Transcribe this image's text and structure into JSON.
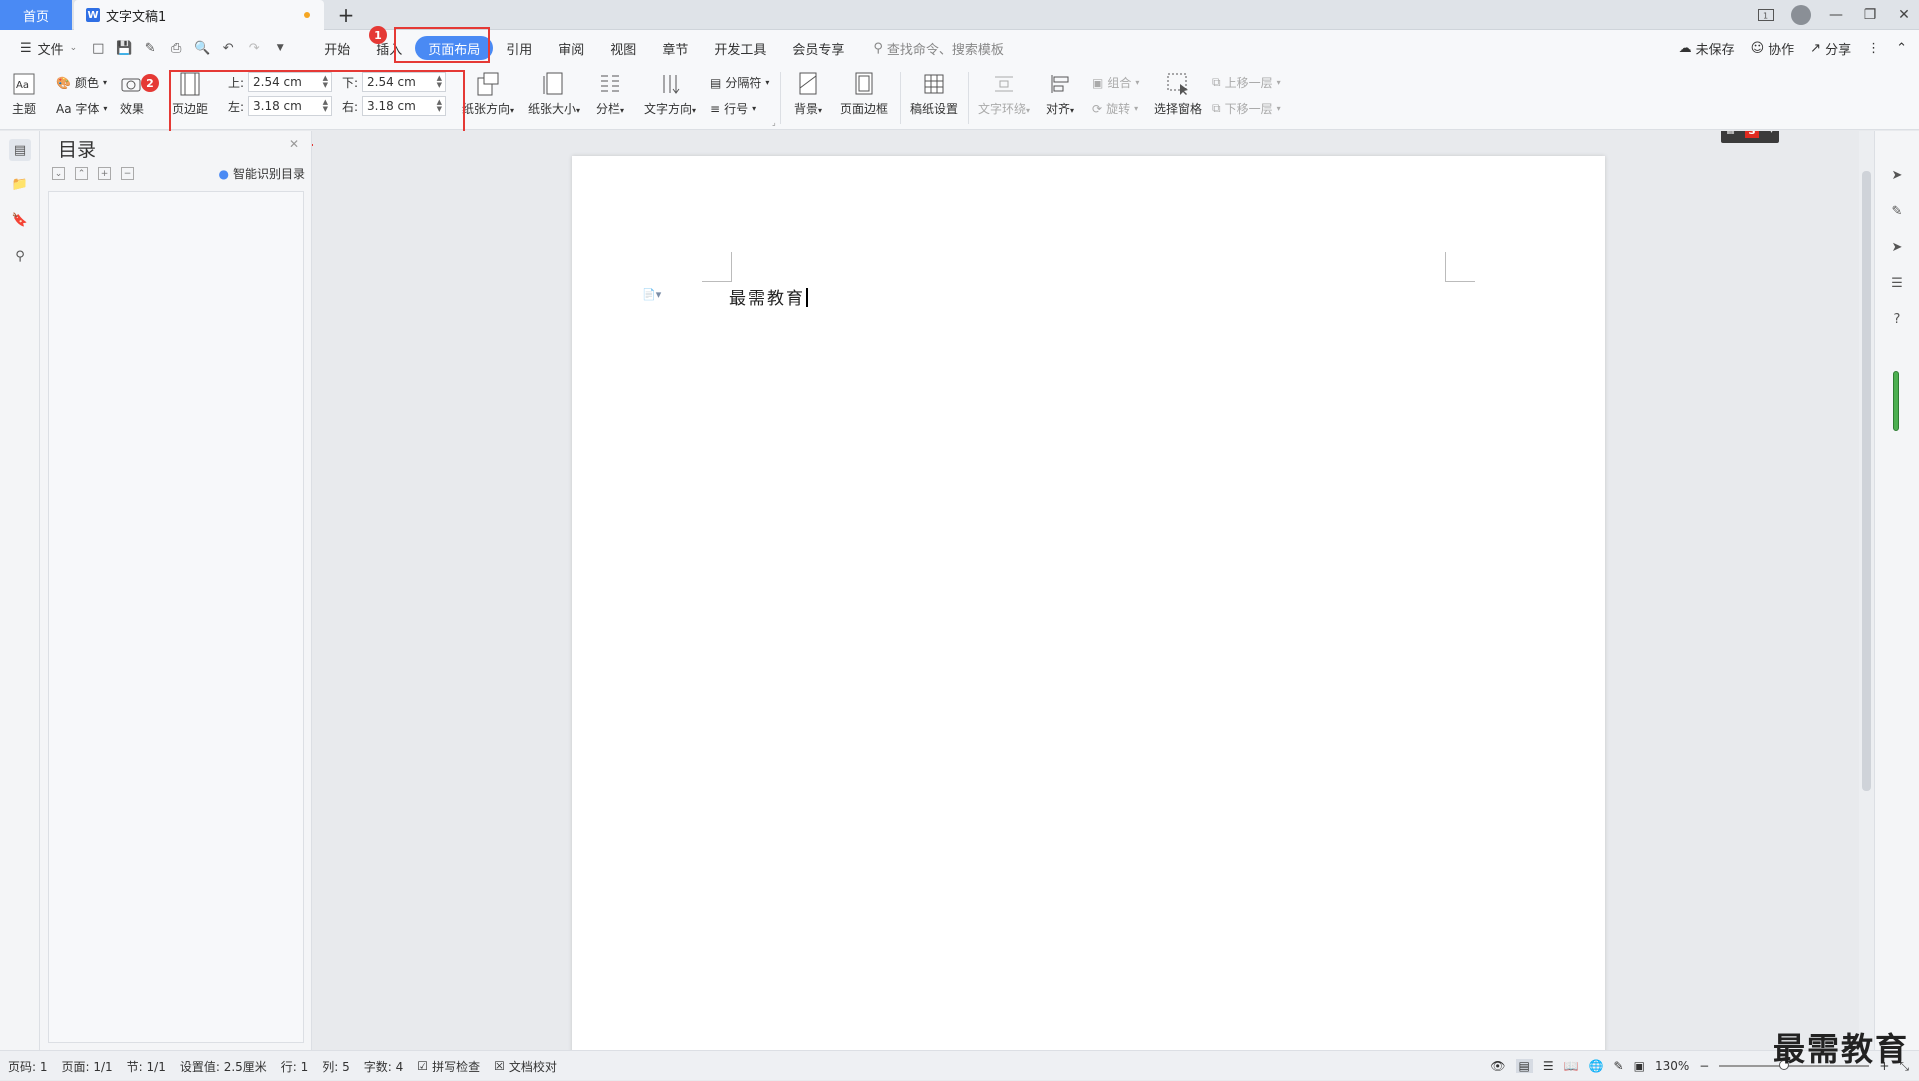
{
  "titlebar": {
    "home_tab": "首页",
    "doc_tab": "文字文稿1",
    "new_tab": "+",
    "page_count_icon": "1"
  },
  "menubar": {
    "file": "文件",
    "tabs": [
      "开始",
      "插入",
      "页面布局",
      "引用",
      "审阅",
      "视图",
      "章节",
      "开发工具",
      "会员专享"
    ],
    "active_tab": "页面布局",
    "search": "查找命令、搜索模板",
    "unsaved": "未保存",
    "collab": "协作",
    "share": "分享"
  },
  "ribbon": {
    "theme": "主题",
    "color": "颜色",
    "font": "Aa 字体",
    "effect": "效果",
    "margins": "页边距",
    "top_label": "上:",
    "top_value": "2.54 cm",
    "bottom_label": "下:",
    "bottom_value": "2.54 cm",
    "left_label": "左:",
    "left_value": "3.18 cm",
    "right_label": "右:",
    "right_value": "3.18 cm",
    "orientation": "纸张方向",
    "size": "纸张大小",
    "columns": "分栏",
    "text_direction": "文字方向",
    "breaks": "分隔符",
    "line_numbers": "行号",
    "background": "背景",
    "page_border": "页面边框",
    "grid_paper": "稿纸设置",
    "text_wrap": "文字环绕",
    "align": "对齐",
    "group": "组合",
    "rotate": "旋转",
    "select_pane": "选择窗格",
    "bring_forward": "上移一层",
    "send_backward": "下移一层"
  },
  "annotations": {
    "badge1": "1",
    "badge2": "2"
  },
  "toc": {
    "title": "目录",
    "smart": "智能识别目录"
  },
  "document": {
    "text": "最需教育"
  },
  "statusbar": {
    "page_no": "页码: 1",
    "pages": "页面: 1/1",
    "section": "节: 1/1",
    "setting": "设置值: 2.5厘米",
    "row": "行: 1",
    "col": "列: 5",
    "words": "字数: 4",
    "spell": "拼写检查",
    "proof": "文档校对",
    "zoom": "130%",
    "zoom_level": 0.4
  },
  "watermark": "最需教育",
  "colors": {
    "accent": "#4a8af4",
    "annotation": "#e53935"
  }
}
